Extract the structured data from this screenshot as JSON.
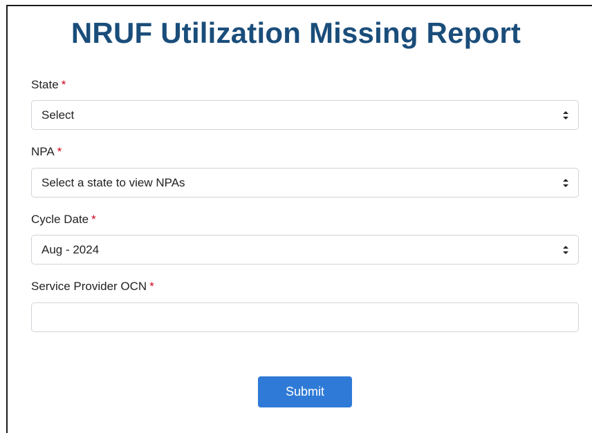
{
  "title": "NRUF Utilization Missing Report",
  "form": {
    "required_marker": "*",
    "state": {
      "label": "State",
      "selected": "Select"
    },
    "npa": {
      "label": "NPA",
      "selected": "Select a state to view NPAs"
    },
    "cycle_date": {
      "label": "Cycle Date",
      "selected": "Aug - 2024"
    },
    "ocn": {
      "label": "Service Provider OCN",
      "value": ""
    },
    "submit_label": "Submit"
  },
  "icons": {
    "select_caret": "up-down-caret-icon"
  },
  "colors": {
    "title": "#1a4d7a",
    "required": "#d0021b",
    "button": "#2f7ad6"
  }
}
